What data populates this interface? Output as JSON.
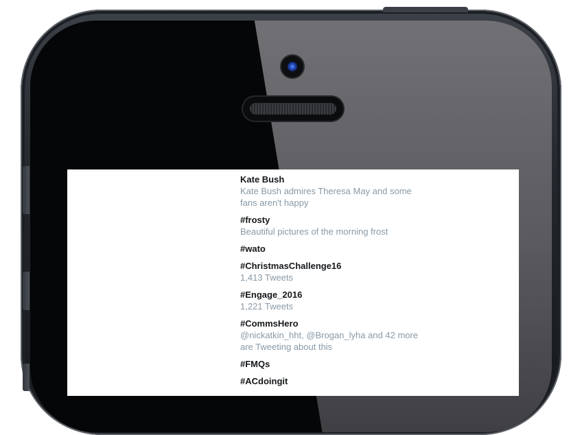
{
  "trends": [
    {
      "name": "Kate Bush",
      "context": "Kate Bush admires Theresa May and some fans aren't happy"
    },
    {
      "name": "#frosty",
      "context": "Beautiful pictures of the morning frost"
    },
    {
      "name": "#wato",
      "context": ""
    },
    {
      "name": "#ChristmasChallenge16",
      "context": "1,413 Tweets"
    },
    {
      "name": "#Engage_2016",
      "context": "1,221 Tweets"
    },
    {
      "name": "#CommsHero",
      "context": "@nickatkin_hht, @Brogan_lyha and 42 more are Tweeting about this"
    },
    {
      "name": "#FMQs",
      "context": ""
    },
    {
      "name": "#ACdoingit",
      "context": ""
    }
  ],
  "colors": {
    "trend_name": "#14171a",
    "trend_context": "#8899a6",
    "phone_frame": "#23272c",
    "camera_lens": "#1c3fa8"
  }
}
